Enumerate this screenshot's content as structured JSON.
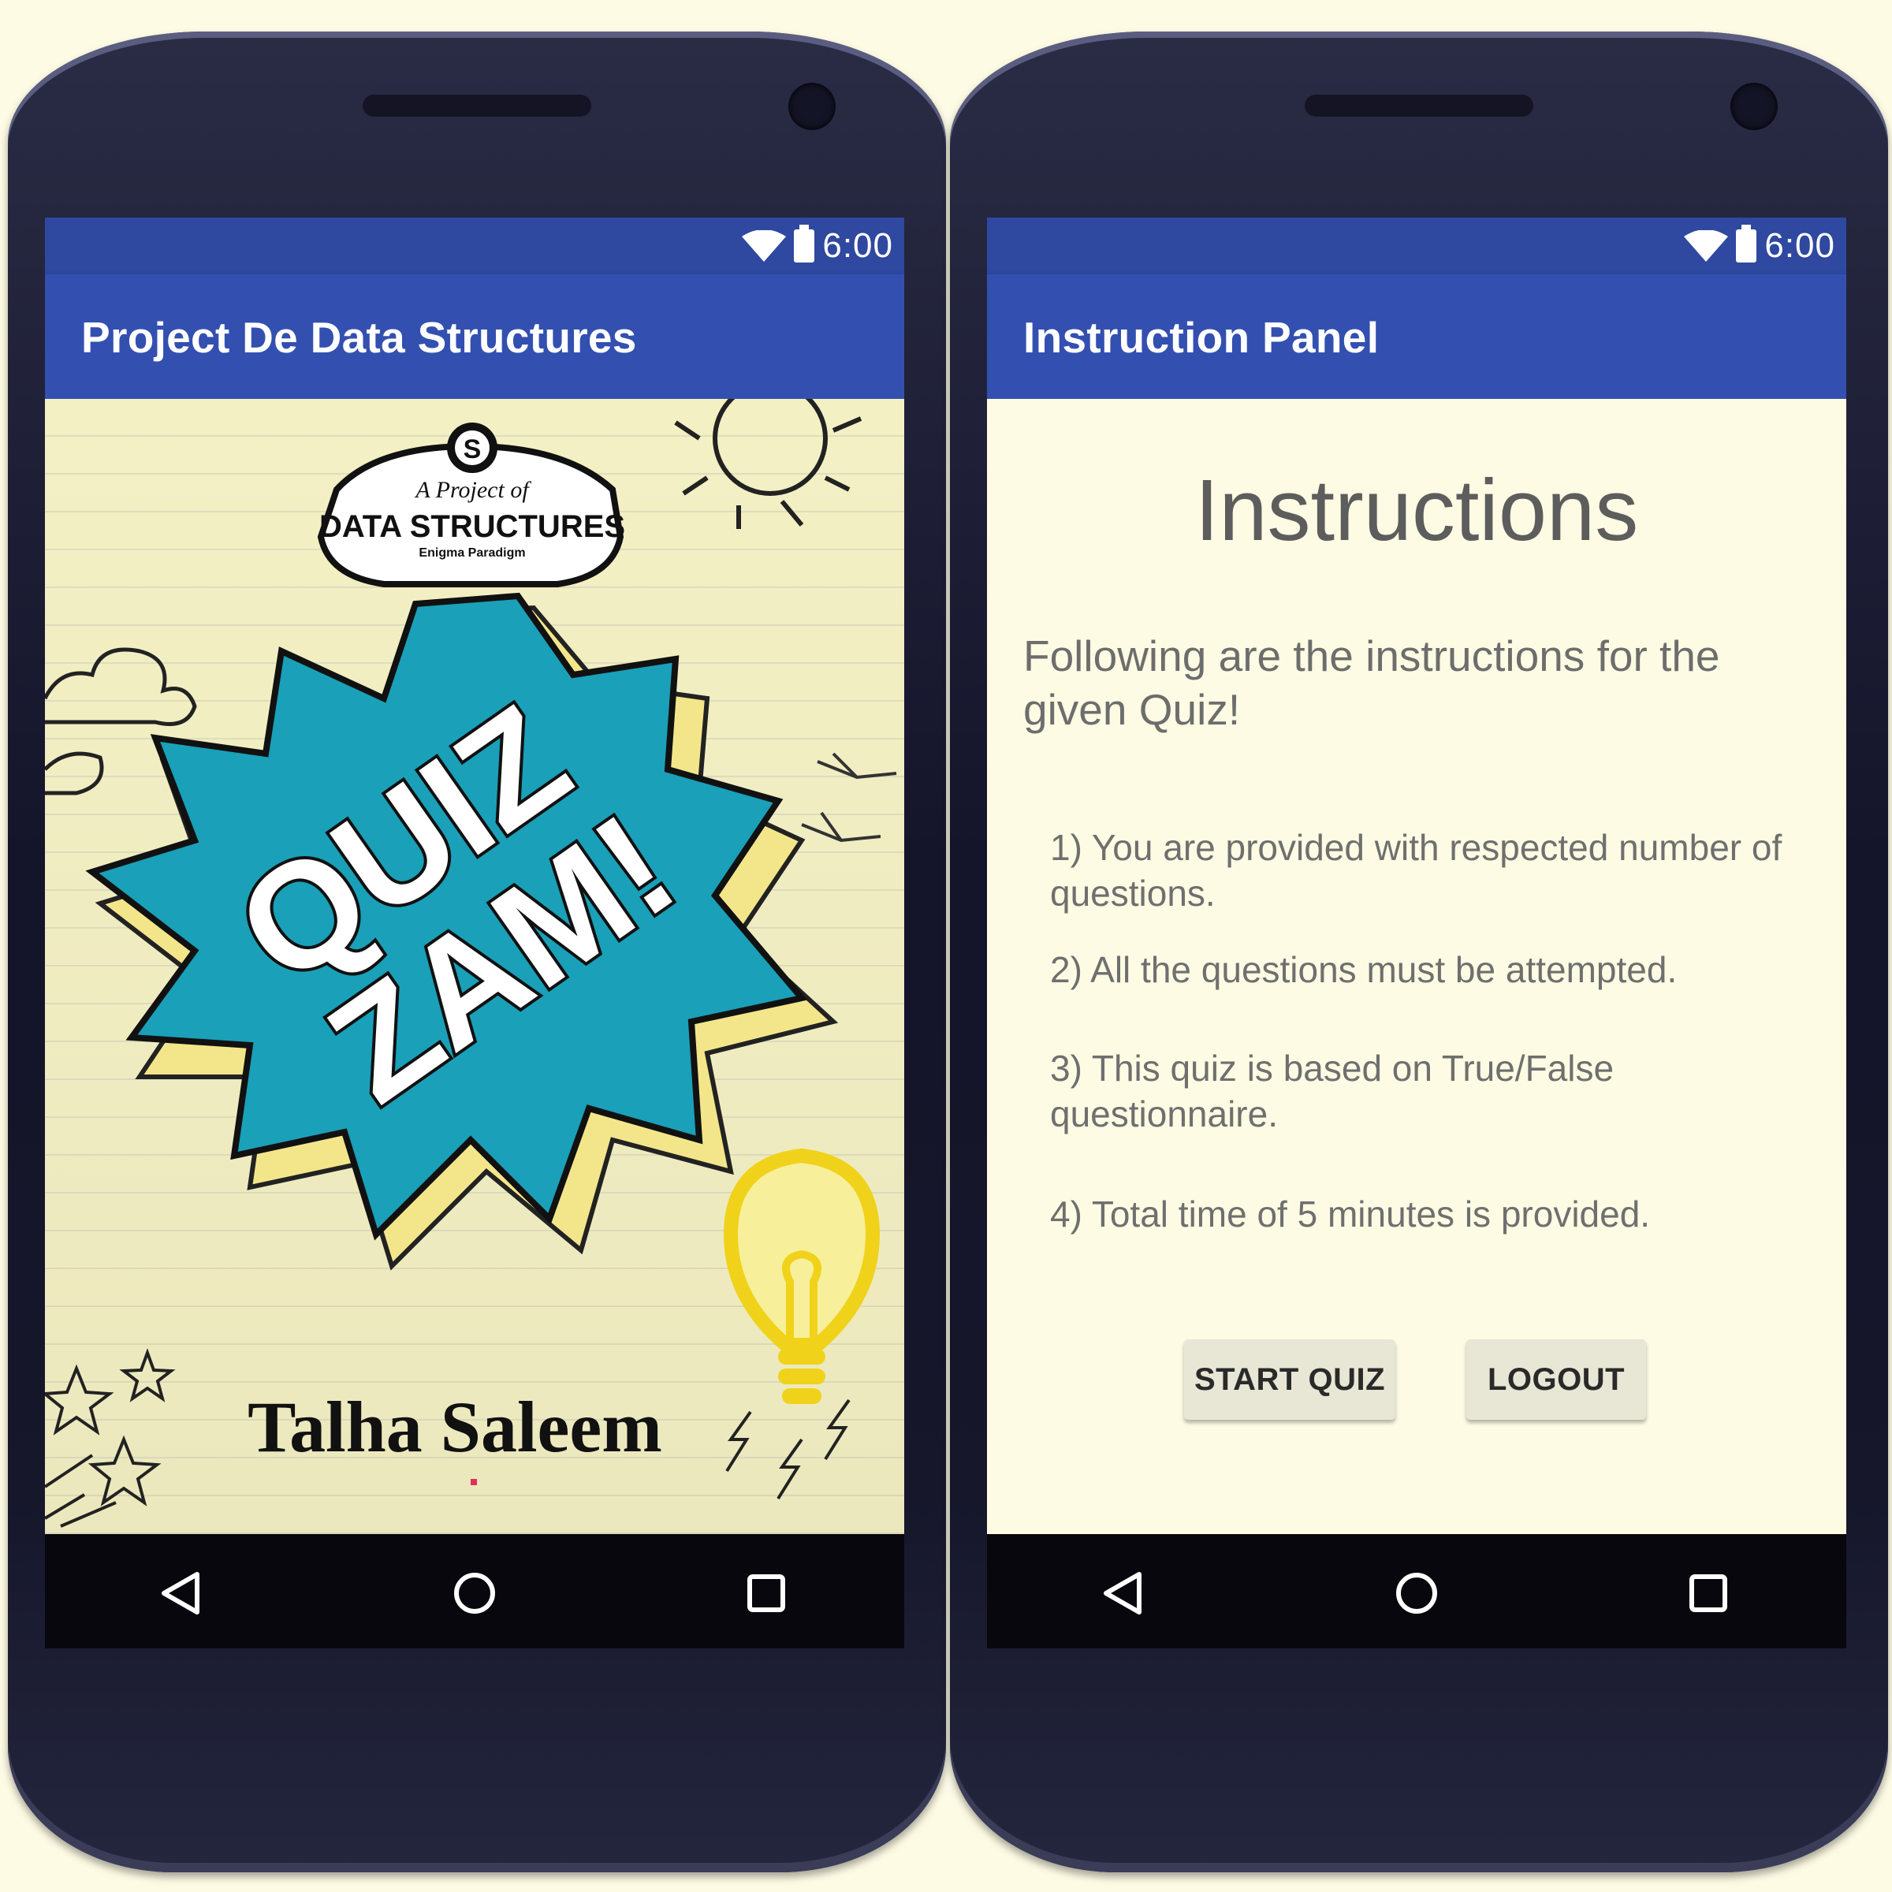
{
  "status_bar": {
    "time": "6:00"
  },
  "left_screen": {
    "app_title": "Project De Data Structures",
    "badge": {
      "letter": "S",
      "line1": "A Project of",
      "line2": "DATA STRUCTURES",
      "line3": "Enigma Paradigm"
    },
    "splash": {
      "word1": "QUIZ",
      "word2": "ZAM!",
      "author": "Talha Saleem"
    }
  },
  "right_screen": {
    "app_title": "Instruction Panel",
    "heading": "Instructions",
    "intro": "Following are the instructions for the given Quiz!",
    "rules": [
      "1) You are provided with respected number of questions.",
      "2) All the questions must be attempted.",
      "3) This quiz is based on True/False questionnaire.",
      "4) Total time of 5 minutes is provided."
    ],
    "start_button": "START QUIZ",
    "logout_button": "LOGOUT"
  },
  "colors": {
    "appbar": "#3350b0",
    "statusbar": "#2f48a0",
    "burst": "#1aa0b8",
    "bulb": "#f0d21a",
    "panel": "#fdfbe3"
  },
  "icons": [
    "wifi-icon",
    "battery-icon",
    "back-icon",
    "home-icon",
    "recents-icon",
    "lightbulb-icon",
    "sun-icon",
    "cloud-icon",
    "bird-icon",
    "star-icon",
    "lightning-icon"
  ]
}
